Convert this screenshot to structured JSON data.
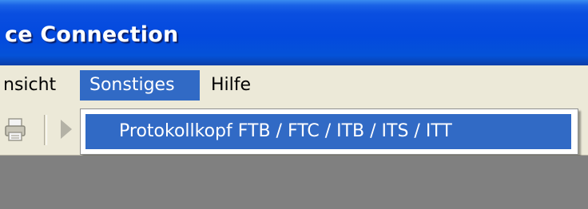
{
  "window": {
    "title": "ce Connection"
  },
  "menubar": {
    "items": [
      {
        "label": "nsicht"
      },
      {
        "label": "Sonstiges"
      },
      {
        "label": "Hilfe"
      }
    ]
  },
  "dropdown": {
    "items": [
      {
        "label": "Protokollkopf FTB / FTC / ITB / ITS / ITT"
      }
    ]
  },
  "toolbar": {
    "buttons": [
      {
        "icon": "print-icon"
      },
      {
        "icon": "play-icon"
      }
    ]
  },
  "colors": {
    "titlebar": "#0349de",
    "menu_bg": "#ece9d8",
    "highlight": "#316ac5",
    "workspace": "#808080"
  }
}
